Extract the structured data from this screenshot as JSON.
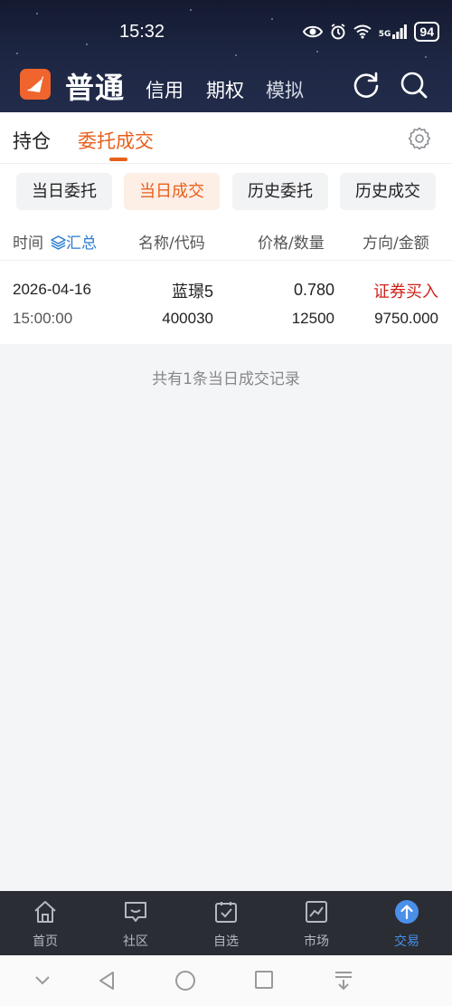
{
  "status": {
    "time": "15:32",
    "network": "5G",
    "battery": "94"
  },
  "app": {
    "brand": "普通",
    "top_tabs": [
      "信用",
      "期权",
      "模拟"
    ]
  },
  "primary_tabs": [
    "持仓",
    "委托成交"
  ],
  "sub_tabs": [
    "当日委托",
    "当日成交",
    "历史委托",
    "历史成交"
  ],
  "columns": {
    "time": "时间",
    "summary_link": "汇总",
    "name_code": "名称/代码",
    "price_qty": "价格/数量",
    "dir_amount": "方向/金额"
  },
  "trades": [
    {
      "date": "2026-04-16",
      "time": "15:00:00",
      "name": "蓝璟5",
      "code": "400030",
      "price": "0.780",
      "quantity": "12500",
      "direction": "证券买入",
      "amount": "9750.000"
    }
  ],
  "summary_text": "共有1条当日成交记录",
  "bottom_nav": [
    "首页",
    "社区",
    "自选",
    "市场",
    "交易"
  ],
  "colors": {
    "accent": "#e8601c",
    "buy": "#d0231b",
    "link": "#2a7bd1",
    "nav_active": "#4a8fe8"
  }
}
